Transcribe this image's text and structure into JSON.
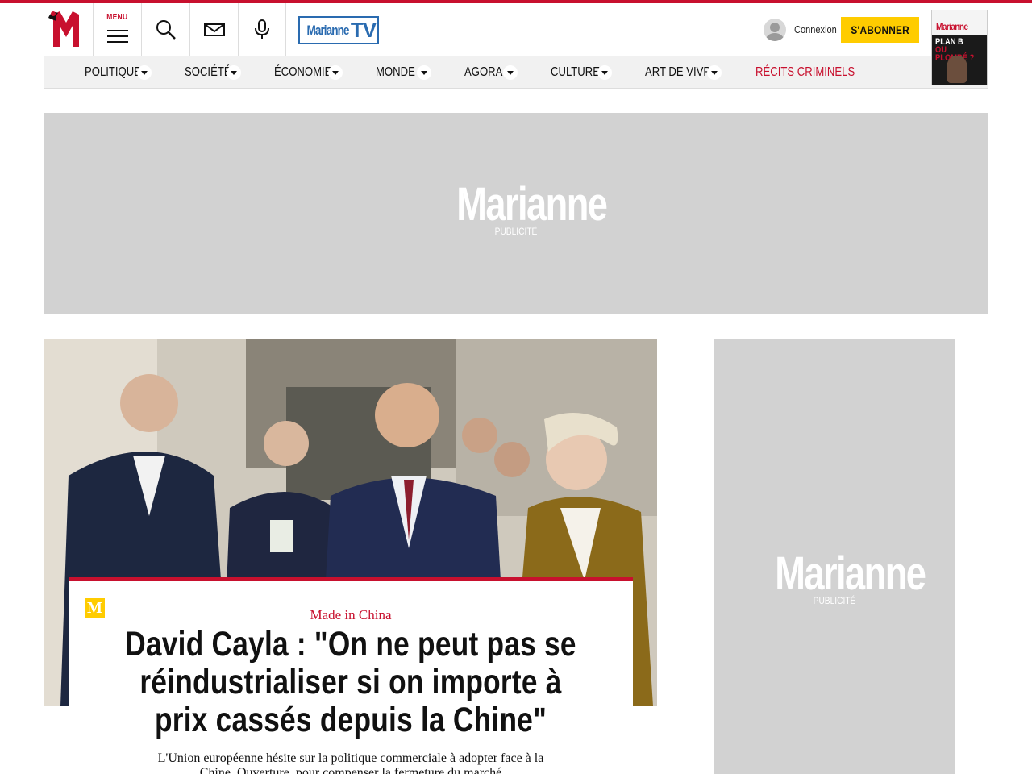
{
  "header": {
    "menu_label": "MENU",
    "tv_label_main": "Marianne",
    "tv_label_tv": "TV",
    "login_label": "Connexion",
    "subscribe_label": "S'ABONNER",
    "cover": {
      "name": "Marianne",
      "headline_a": "PLAN B",
      "headline_b": "OU PLOMBÉ ?"
    }
  },
  "nav": {
    "items": [
      {
        "label": "POLITIQUE"
      },
      {
        "label": "SOCIÉTÉ"
      },
      {
        "label": "ÉCONOMIE"
      },
      {
        "label": "MONDE"
      },
      {
        "label": "AGORA"
      },
      {
        "label": "CULTURE"
      },
      {
        "label": "ART DE VIVRE"
      },
      {
        "label": "RÉCITS CRIMINELS"
      }
    ]
  },
  "ads": {
    "banner": {
      "brand": "Marianne",
      "label": "PUBLICITÉ"
    },
    "side": {
      "brand": "Marianne",
      "label": "PUBLICITÉ"
    }
  },
  "article": {
    "badge": "M",
    "kicker": "Made in China",
    "headline": "David Cayla : \"On ne peut pas se réindustrialiser si on importe à prix cassés depuis la Chine\"",
    "standfirst": "L'Union européenne hésite sur la politique commerciale à adopter face à la Chine. Ouverture, pour compenser la fermeture du marché"
  },
  "colors": {
    "brand_red": "#c8102e",
    "accent_yellow": "#ffcc00",
    "ad_gray": "#d2d2d2",
    "tv_blue": "#2a6bb0"
  },
  "icons": [
    "marianne-logo-icon",
    "hamburger-icon",
    "search-icon",
    "mail-icon",
    "microphone-icon",
    "user-avatar-icon",
    "caret-down-icon"
  ]
}
